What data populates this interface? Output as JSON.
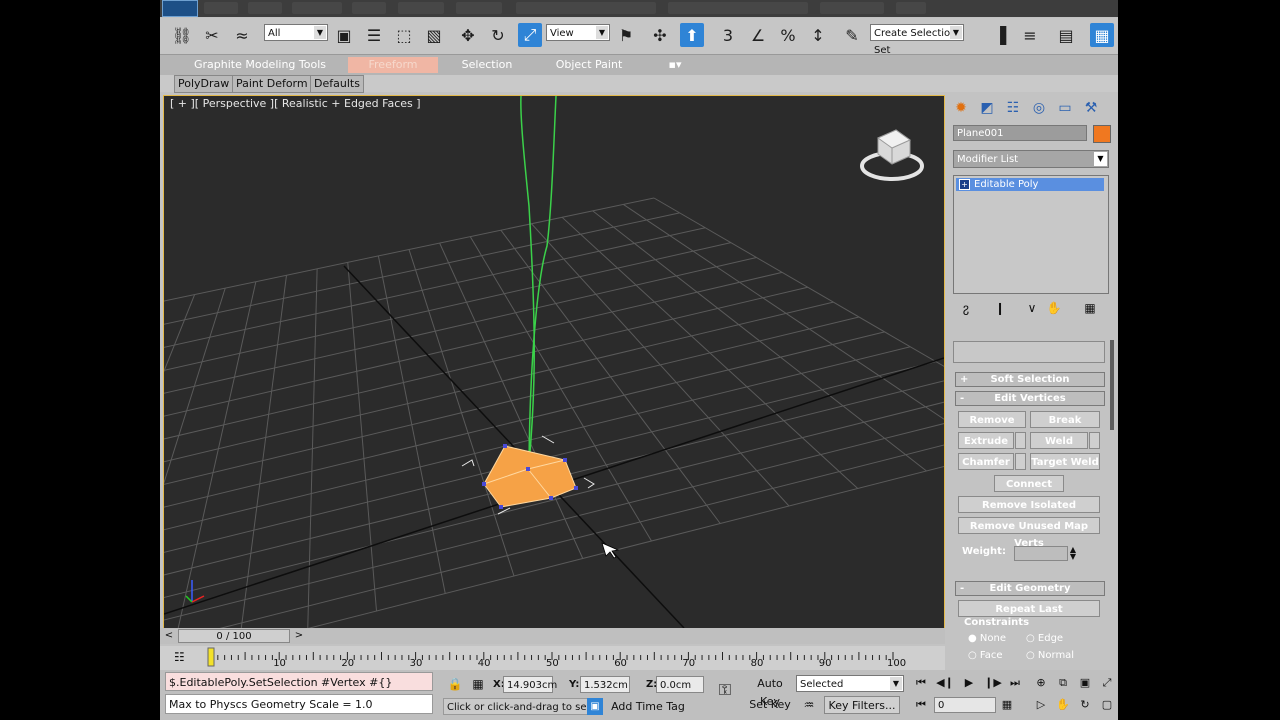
{
  "toolbar": {
    "selection_filter": "All",
    "reference_coord": "View",
    "named_selection": "Create Selection Set"
  },
  "ribbon": {
    "tabs": [
      "Graphite Modeling Tools",
      "Freeform",
      "Selection",
      "Object Paint"
    ],
    "subtabs": [
      "PolyDraw",
      "Paint Deform",
      "Defaults"
    ]
  },
  "viewport": {
    "label": "[ + ][ Perspective ][ Realistic + Edged Faces ]"
  },
  "command_panel": {
    "object_name": "Plane001",
    "object_color": "#f07820",
    "modifier_list": "Modifier List",
    "stack_item": "Editable Poly",
    "soft_selection": "Soft Selection",
    "edit_vertices": "Edit Vertices",
    "remove": "Remove",
    "break": "Break",
    "extrude": "Extrude",
    "weld": "Weld",
    "chamfer": "Chamfer",
    "target_weld": "Target Weld",
    "connect": "Connect",
    "remove_isolated": "Remove Isolated Vertices",
    "remove_unused": "Remove Unused Map Verts",
    "weight_label": "Weight:",
    "edit_geometry": "Edit Geometry",
    "repeat_last": "Repeat Last",
    "constraints": "Constraints",
    "c_none": "None",
    "c_edge": "Edge",
    "c_face": "Face",
    "c_normal": "Normal"
  },
  "timeline": {
    "frame": "0 / 100",
    "ticks": [
      "10",
      "20",
      "30",
      "40",
      "50",
      "60",
      "70",
      "80",
      "90",
      "100"
    ]
  },
  "status": {
    "maxscript": "$.EditablePoly.SetSelection #Vertex #{}",
    "message": "Max to Physcs Geometry Scale = 1.0",
    "prompt": "Click or click-and-drag to select",
    "add_time_tag": "Add Time Tag",
    "x_label": "X:",
    "x_value": "14.903cm",
    "y_label": "Y:",
    "y_value": "1.532cm",
    "z_label": "Z:",
    "z_value": "0.0cm",
    "auto_key": "Auto Key",
    "set_key": "Set Key",
    "key_mode": "Selected",
    "key_filters": "Key Filters...",
    "current_frame": "0"
  }
}
